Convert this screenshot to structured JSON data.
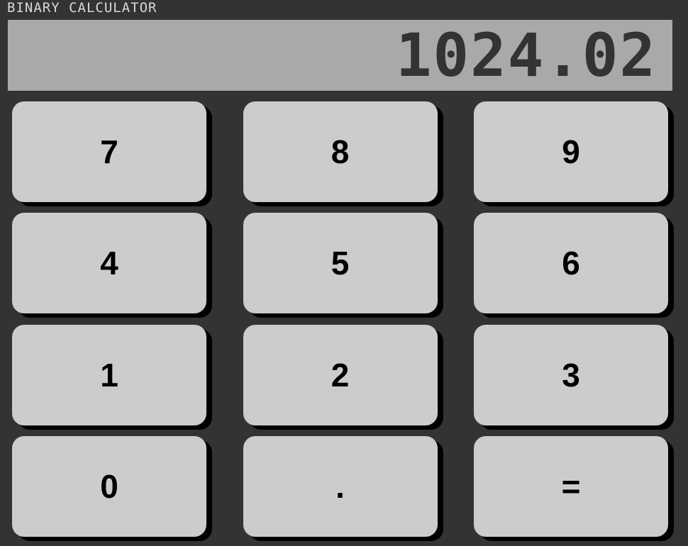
{
  "app": {
    "title": "BINARY CALCULATOR"
  },
  "display": {
    "value": "1024.02"
  },
  "keypad": {
    "keys": [
      "7",
      "8",
      "9",
      "4",
      "5",
      "6",
      "1",
      "2",
      "3",
      "0",
      ".",
      "="
    ]
  },
  "colors": {
    "background": "#333333",
    "display_background": "#a9a9a9",
    "display_text": "#333333",
    "key_background": "#cccccc",
    "key_text": "#000000",
    "key_shadow": "#000000"
  }
}
